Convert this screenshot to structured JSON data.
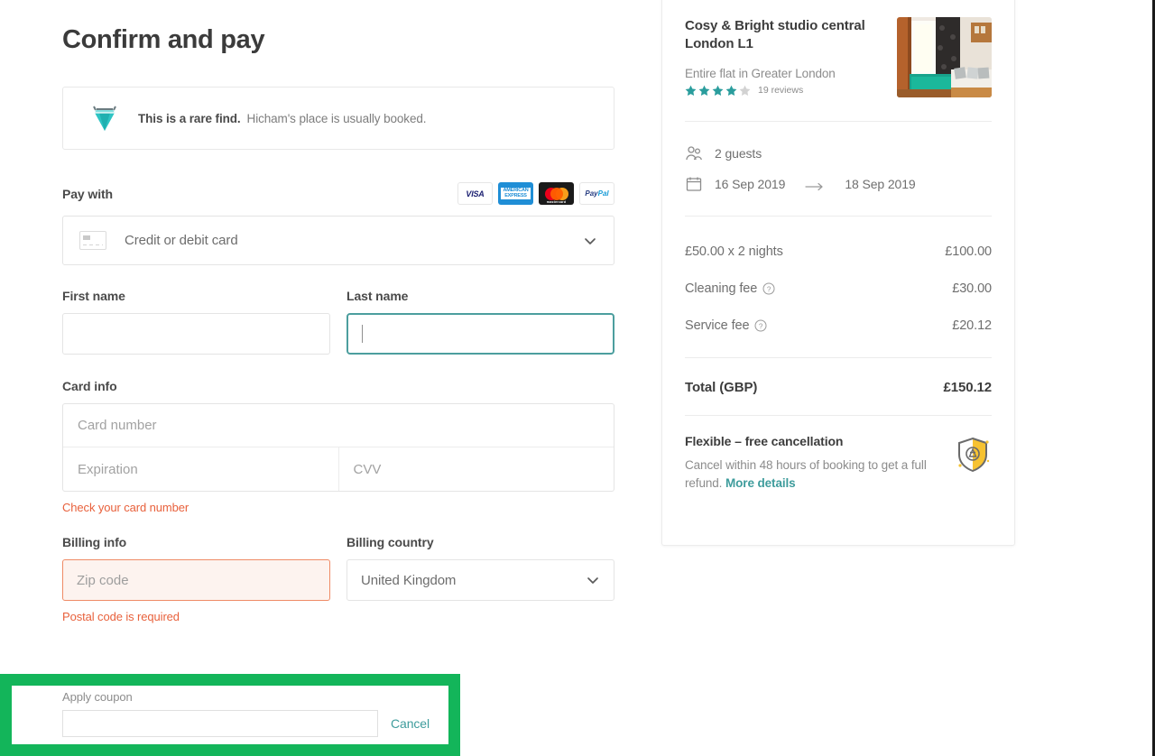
{
  "page": {
    "title": "Confirm and pay"
  },
  "rare_find": {
    "icon": "gem-icon",
    "headline": "This is a rare find.",
    "subtext": "Hicham's place is usually booked."
  },
  "pay_with": {
    "label": "Pay with",
    "card_logos": [
      {
        "name": "visa-logo",
        "text": "VISA"
      },
      {
        "name": "amex-logo",
        "text": "AMERICAN EXPRESS"
      },
      {
        "name": "mastercard-logo",
        "text": "mastercard"
      },
      {
        "name": "paypal-logo",
        "text": "PayPal"
      }
    ],
    "method_selected": "Credit or debit card",
    "method_icon": "credit-card-icon",
    "chevron_icon": "chevron-down-icon"
  },
  "first_name": {
    "label": "First name",
    "value": ""
  },
  "last_name": {
    "label": "Last name",
    "value": "",
    "focused": true
  },
  "card_info": {
    "label": "Card info",
    "card_number_placeholder": "Card number",
    "card_number_value": "",
    "expiration_placeholder": "Expiration",
    "expiration_value": "",
    "cvv_placeholder": "CVV",
    "cvv_value": "",
    "error": "Check your card number"
  },
  "billing": {
    "info_label": "Billing info",
    "zip_placeholder": "Zip code",
    "zip_value": "",
    "zip_error": "Postal code is required",
    "country_label": "Billing country",
    "country_value": "United Kingdom",
    "chevron_icon": "chevron-down-icon"
  },
  "coupon": {
    "label": "Apply coupon",
    "value": "",
    "cancel_label": "Cancel",
    "highlight_color": "#13b55a"
  },
  "listing": {
    "title": "Cosy & Bright studio central London L1",
    "subtitle": "Entire flat in Greater London",
    "rating_filled": 4,
    "rating_total": 5,
    "reviews": "19 reviews",
    "thumbnail_alt": "studio-room-photo"
  },
  "stay": {
    "guests_icon": "guests-icon",
    "guests": "2 guests",
    "calendar_icon": "calendar-icon",
    "check_in": "16 Sep 2019",
    "arrow_icon": "arrow-right-icon",
    "check_out": "18 Sep 2019"
  },
  "price_breakdown": {
    "rows": [
      {
        "label": "£50.00 x 2 nights",
        "amount": "£100.00",
        "has_info": false
      },
      {
        "label": "Cleaning fee",
        "amount": "£30.00",
        "has_info": true
      },
      {
        "label": "Service fee",
        "amount": "£20.12",
        "has_info": true
      }
    ],
    "total_label": "Total (GBP)",
    "total_amount": "£150.12"
  },
  "cancellation": {
    "title": "Flexible – free cancellation",
    "body": "Cancel within 48 hours of booking to get a full refund.",
    "link": "More details",
    "icon": "shield-icon"
  },
  "colors": {
    "accent_teal": "#3e9c9c",
    "error_orange": "#e8613c",
    "highlight_green": "#13b55a",
    "star_teal": "#2a9d9d"
  }
}
